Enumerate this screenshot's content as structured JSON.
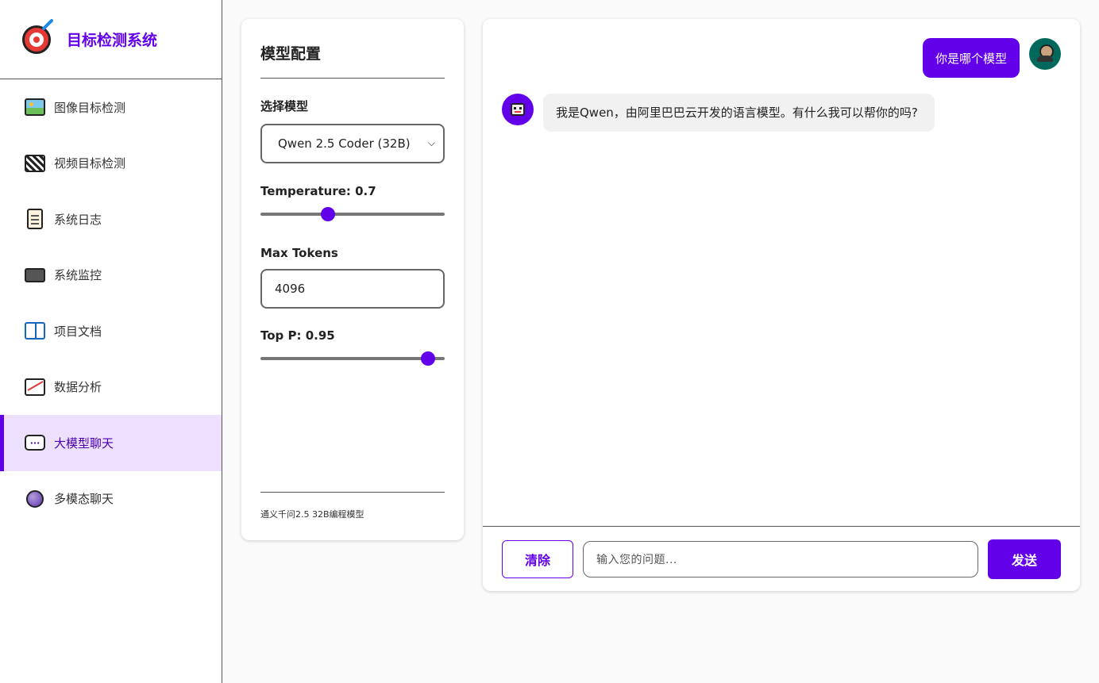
{
  "brand": {
    "title": "目标检测系统",
    "logo_icon": "target-dart-icon"
  },
  "sidebar": {
    "items": [
      {
        "label": "图像目标检测",
        "icon": "image-icon",
        "active": false
      },
      {
        "label": "视频目标检测",
        "icon": "clapperboard-icon",
        "active": false
      },
      {
        "label": "系统日志",
        "icon": "clipboard-icon",
        "active": false
      },
      {
        "label": "系统监控",
        "icon": "laptop-icon",
        "active": false
      },
      {
        "label": "项目文档",
        "icon": "book-icon",
        "active": false
      },
      {
        "label": "数据分析",
        "icon": "chart-increasing-icon",
        "active": false
      },
      {
        "label": "大模型聊天",
        "icon": "speech-bubble-icon",
        "active": true
      },
      {
        "label": "多模态聊天",
        "icon": "crystal-ball-icon",
        "active": false
      }
    ]
  },
  "config": {
    "title": "模型配置",
    "model_label": "选择模型",
    "model_selected": "Qwen 2.5 Coder (32B)",
    "temperature_label": "Temperature: 0.7",
    "temperature_value": 0.7,
    "max_tokens_label": "Max Tokens",
    "max_tokens_value": "4096",
    "top_p_label": "Top P: 0.95",
    "top_p_value": 0.95,
    "footer": "通义千问2.5 32B编程模型"
  },
  "chat": {
    "messages": [
      {
        "role": "user",
        "text": "你是哪个模型"
      },
      {
        "role": "assistant",
        "text": "我是Qwen，由阿里巴巴云开发的语言模型。有什么我可以帮你的吗?"
      }
    ],
    "clear_label": "清除",
    "input_placeholder": "输入您的问题...",
    "send_label": "发送"
  },
  "colors": {
    "accent": "#6200ea",
    "active_bg": "#ede0fd",
    "user_avatar": "#00695c"
  }
}
